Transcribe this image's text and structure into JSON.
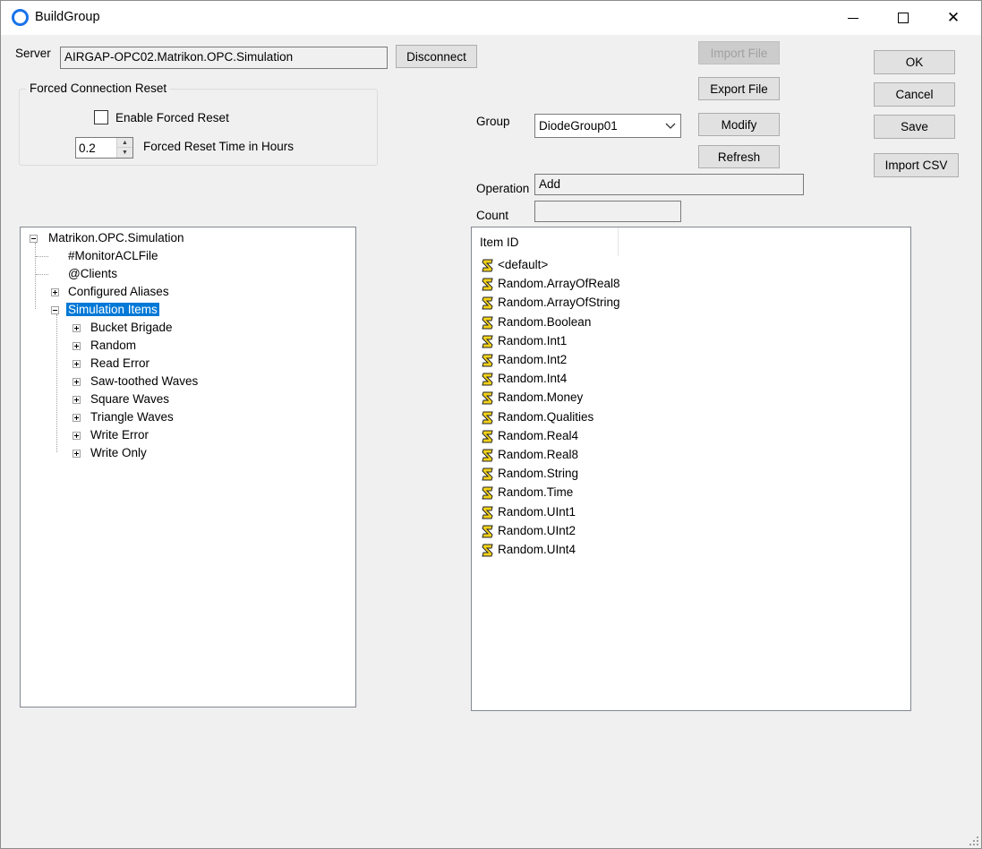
{
  "window": {
    "title": "BuildGroup"
  },
  "server": {
    "label": "Server",
    "value": "AIRGAP-OPC02.Matrikon.OPC.Simulation",
    "disconnect_label": "Disconnect"
  },
  "forced_reset": {
    "legend": "Forced Connection Reset",
    "enable_label": "Enable Forced Reset",
    "time_value": "0.2",
    "time_label": "Forced Reset Time in Hours"
  },
  "file_buttons": {
    "import_file": "Import File",
    "export_file": "Export File",
    "modify": "Modify",
    "refresh": "Refresh"
  },
  "group": {
    "label": "Group",
    "selected": "DiodeGroup01"
  },
  "operation": {
    "label": "Operation",
    "value": "Add"
  },
  "count": {
    "label": "Count",
    "value": ""
  },
  "actions": {
    "ok": "OK",
    "cancel": "Cancel",
    "save": "Save",
    "import_csv": "Import CSV"
  },
  "tree": {
    "root": "Matrikon.OPC.Simulation",
    "level1": [
      "#MonitorACLFile",
      "@Clients",
      "Configured Aliases",
      "Simulation Items"
    ],
    "level2": [
      "Bucket Brigade",
      "Random",
      "Read Error",
      "Saw-toothed Waves",
      "Square Waves",
      "Triangle Waves",
      "Write Error",
      "Write Only"
    ]
  },
  "items": {
    "header": "Item ID",
    "rows": [
      "<default>",
      "Random.ArrayOfReal8",
      "Random.ArrayOfString",
      "Random.Boolean",
      "Random.Int1",
      "Random.Int2",
      "Random.Int4",
      "Random.Money",
      "Random.Qualities",
      "Random.Real4",
      "Random.Real8",
      "Random.String",
      "Random.Time",
      "Random.UInt1",
      "Random.UInt2",
      "Random.UInt4"
    ]
  },
  "colors": {
    "accent": "#0078d7",
    "window_bg": "#f0f0f0",
    "tag_icon": "#f2d21a"
  }
}
